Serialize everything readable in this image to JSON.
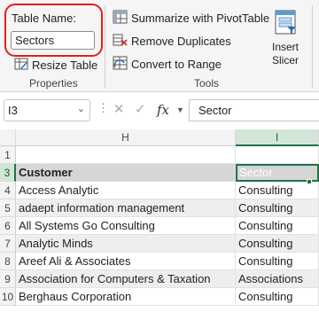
{
  "ribbon": {
    "table_name_label": "Table Name:",
    "table_name_value": "Sectors",
    "resize_table_label": "Resize Table",
    "properties_group_label": "Properties",
    "tools": [
      {
        "label": "Summarize with PivotTable",
        "icon": "pivot-table-icon"
      },
      {
        "label": "Remove Duplicates",
        "icon": "remove-duplicates-icon"
      },
      {
        "label": "Convert to Range",
        "icon": "convert-range-icon"
      }
    ],
    "tools_group_label": "Tools",
    "insert_slicer_line1": "Insert",
    "insert_slicer_line2": "Slicer"
  },
  "formula_bar": {
    "name_box": "I3",
    "formula": "Sector"
  },
  "grid": {
    "columns": [
      "H",
      "I"
    ],
    "rows": [
      {
        "num": "1",
        "h": "",
        "i": ""
      },
      {
        "num": "2",
        "h": "",
        "i": ""
      },
      {
        "num": "3",
        "h": "Customer",
        "i": "Sector"
      },
      {
        "num": "4",
        "h": "Access Analytic",
        "i": "Consulting"
      },
      {
        "num": "5",
        "h": "adaept information management",
        "i": "Consulting"
      },
      {
        "num": "6",
        "h": "All Systems Go Consulting",
        "i": "Consulting"
      },
      {
        "num": "7",
        "h": "Analytic Minds",
        "i": "Consulting"
      },
      {
        "num": "8",
        "h": "Areef Ali & Associates",
        "i": "Consulting"
      },
      {
        "num": "9",
        "h": "Association for Computers & Taxation",
        "i": "Associations"
      },
      {
        "num": "10",
        "h": "Berghaus Corporation",
        "i": "Consulting"
      }
    ]
  },
  "colors": {
    "accent_green": "#217346",
    "selected_header_bg": "#d2e6d8",
    "highlight_outline": "#e02020",
    "table_header_bg": "#d6d6d6",
    "band_bg": "#eeeeee"
  }
}
